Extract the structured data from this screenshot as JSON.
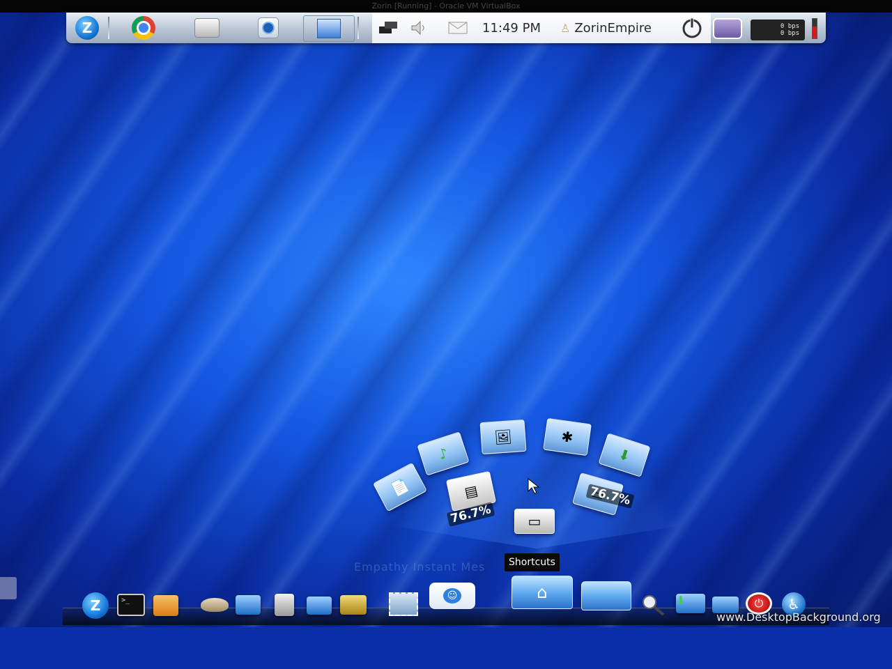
{
  "vm_window": {
    "title": "Zorin [Running] - Oracle VM VirtualBox"
  },
  "top_panel": {
    "launchers": [
      {
        "name": "zorin-menu",
        "icon": "zorin-logo-icon",
        "glyph": "Z"
      },
      {
        "name": "chrome",
        "icon": "chrome-icon"
      },
      {
        "name": "file-manager",
        "icon": "drive-icon",
        "glyph": "▭"
      },
      {
        "name": "software",
        "icon": "software-center-icon",
        "glyph": "◉"
      },
      {
        "name": "workspace",
        "icon": "workspace-switcher-icon",
        "glyph": "▦"
      }
    ],
    "tray": {
      "clock": "11:49 PM",
      "username": "ZorinEmpire",
      "net_down": "0 bps",
      "net_up": "0 bps"
    }
  },
  "shortcuts_stack": {
    "tooltip": "Shortcuts",
    "ghost_label": "Empathy Instant Mes",
    "gauge_left": "76.7%",
    "gauge_right": "76.7%",
    "items": [
      {
        "name": "documents-folder",
        "glyph": "📄"
      },
      {
        "name": "music-folder",
        "glyph": "♪"
      },
      {
        "name": "pictures-folder",
        "glyph": "🖼"
      },
      {
        "name": "network-folder",
        "glyph": "✱"
      },
      {
        "name": "downloads-folder",
        "glyph": "⬇"
      },
      {
        "name": "home-drive",
        "glyph": "▤"
      },
      {
        "name": "optical-drive",
        "glyph": "▭"
      }
    ]
  },
  "dock": {
    "items": [
      {
        "name": "zorin-menu",
        "glyph": "Z"
      },
      {
        "name": "terminal",
        "glyph": ">_"
      },
      {
        "name": "archive-manager",
        "glyph": "▣"
      },
      {
        "name": "gimp",
        "glyph": "✎"
      },
      {
        "name": "system-monitor",
        "glyph": "▦"
      },
      {
        "name": "calculator",
        "glyph": "▤"
      },
      {
        "name": "file-folder",
        "glyph": "▭"
      },
      {
        "name": "photo-viewer",
        "glyph": "★"
      },
      {
        "name": "empathy-chat",
        "glyph": "☺"
      },
      {
        "name": "home-folder",
        "glyph": "⌂"
      },
      {
        "name": "documents-stack",
        "glyph": "📄"
      },
      {
        "name": "search",
        "glyph": "🔍"
      },
      {
        "name": "downloads-folder",
        "glyph": "⬇"
      },
      {
        "name": "desktop-folder",
        "glyph": "▭"
      },
      {
        "name": "shutdown",
        "glyph": "⏻"
      },
      {
        "name": "accessibility",
        "glyph": "♿"
      }
    ]
  },
  "watermark": "www.DesktopBackground.org",
  "colors": {
    "desktop_blue": "#1456e0",
    "panel_gray": "#b9c6d6",
    "tooltip_bg": "#0a0a0a"
  }
}
